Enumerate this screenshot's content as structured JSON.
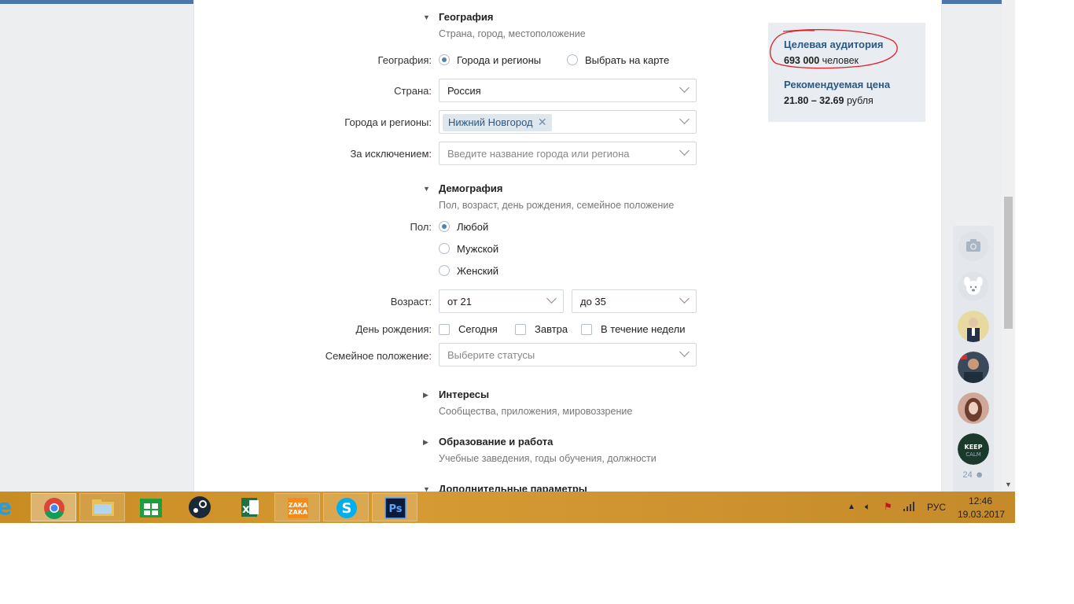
{
  "geo": {
    "title": "География",
    "subtitle": "Страна, город, местоположение",
    "mode_label": "География:",
    "mode_option_1": "Города и регионы",
    "mode_option_2": "Выбрать на карте",
    "country_label": "Страна:",
    "country_value": "Россия",
    "cities_label": "Города и регионы:",
    "city_token": "Нижний Новгород",
    "except_label": "За исключением:",
    "except_placeholder": "Введите название города или региона"
  },
  "demo": {
    "title": "Демография",
    "subtitle": "Пол, возраст, день рождения, семейное положение",
    "sex_label": "Пол:",
    "sex_any": "Любой",
    "sex_male": "Мужской",
    "sex_female": "Женский",
    "age_label": "Возраст:",
    "age_from": "от 21",
    "age_to": "до 35",
    "bday_label": "День рождения:",
    "bday_today": "Сегодня",
    "bday_tomorrow": "Завтра",
    "bday_week": "В течение недели",
    "family_label": "Семейное положение:",
    "family_placeholder": "Выберите статусы"
  },
  "interests": {
    "title": "Интересы",
    "subtitle": "Сообщества, приложения, мировоззрение"
  },
  "education": {
    "title": "Образование и работа",
    "subtitle": "Учебные заведения, годы обучения, должности"
  },
  "extra": {
    "title": "Дополнительные параметры"
  },
  "summary": {
    "audience_label": "Целевая аудитория",
    "audience_count": "693 000",
    "audience_unit": "человек",
    "price_label": "Рекомендуемая цена",
    "price_range": "21.80 – 32.69",
    "price_unit": "рубля"
  },
  "friends": {
    "online_count": "24"
  },
  "taskbar": {
    "apps": [
      "Internet Explorer",
      "Google Chrome",
      "File Explorer",
      "Store",
      "Steam",
      "Excel",
      "ZakaZaka",
      "Skype",
      "Photoshop"
    ],
    "language": "РУС",
    "time": "12:46",
    "date": "19.03.2017"
  },
  "colors": {
    "accent": "#2a5885",
    "radio": "#5181b8",
    "taskbar": "#c98c22",
    "annotation": "#e0202a"
  }
}
